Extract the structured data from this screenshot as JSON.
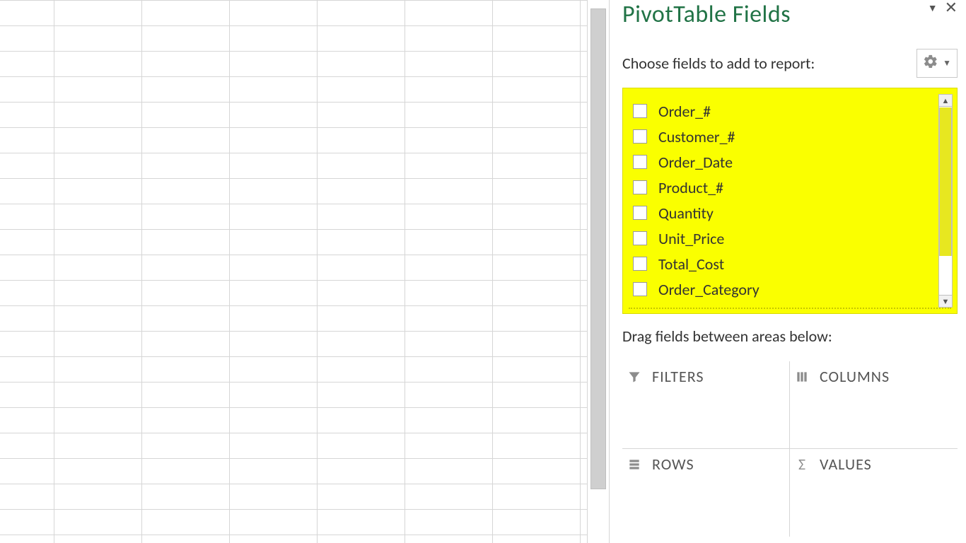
{
  "panel": {
    "title": "PivotTable Fields",
    "subheader": "Choose fields to add to report:",
    "drag_hint": "Drag fields between areas below:"
  },
  "fields": [
    {
      "label": "Order_#",
      "checked": false
    },
    {
      "label": "Customer_#",
      "checked": false
    },
    {
      "label": "Order_Date",
      "checked": false
    },
    {
      "label": "Product_#",
      "checked": false
    },
    {
      "label": "Quantity",
      "checked": false
    },
    {
      "label": "Unit_Price",
      "checked": false
    },
    {
      "label": "Total_Cost",
      "checked": false
    },
    {
      "label": "Order_Category",
      "checked": false
    }
  ],
  "areas": {
    "filters": "FILTERS",
    "columns": "COLUMNS",
    "rows": "ROWS",
    "values": "VALUES"
  },
  "colors": {
    "accent": "#217346",
    "highlight": "#faff00"
  }
}
